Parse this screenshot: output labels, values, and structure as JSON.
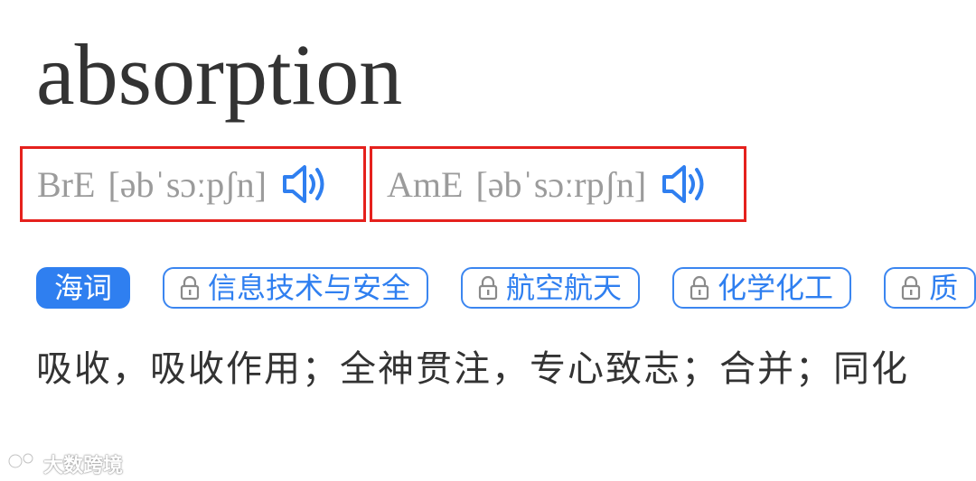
{
  "entry": {
    "word": "absorption"
  },
  "pronunciations": [
    {
      "region": "BrE",
      "ipa": "[əbˈsɔːpʃn]",
      "icon": "speaker-icon"
    },
    {
      "region": "AmE",
      "ipa": "[əbˈsɔːrpʃn]",
      "icon": "speaker-icon"
    }
  ],
  "tags": [
    {
      "label": "海词",
      "locked": false
    },
    {
      "label": "信息技术与安全",
      "locked": true,
      "icon": "lock-icon"
    },
    {
      "label": "航空航天",
      "locked": true,
      "icon": "lock-icon"
    },
    {
      "label": "化学化工",
      "locked": true,
      "icon": "lock-icon"
    },
    {
      "label": "质",
      "locked": true,
      "icon": "lock-icon"
    }
  ],
  "definition": "吸收，吸收作用；全神贯注，专心致志；合并；同化",
  "watermark": {
    "text": "大数跨境",
    "icon": "logo-icon"
  },
  "colors": {
    "accent": "#2f7ff0",
    "highlight_border": "#e5211d",
    "pron_text": "#9b9b9b",
    "word_text": "#333333"
  }
}
